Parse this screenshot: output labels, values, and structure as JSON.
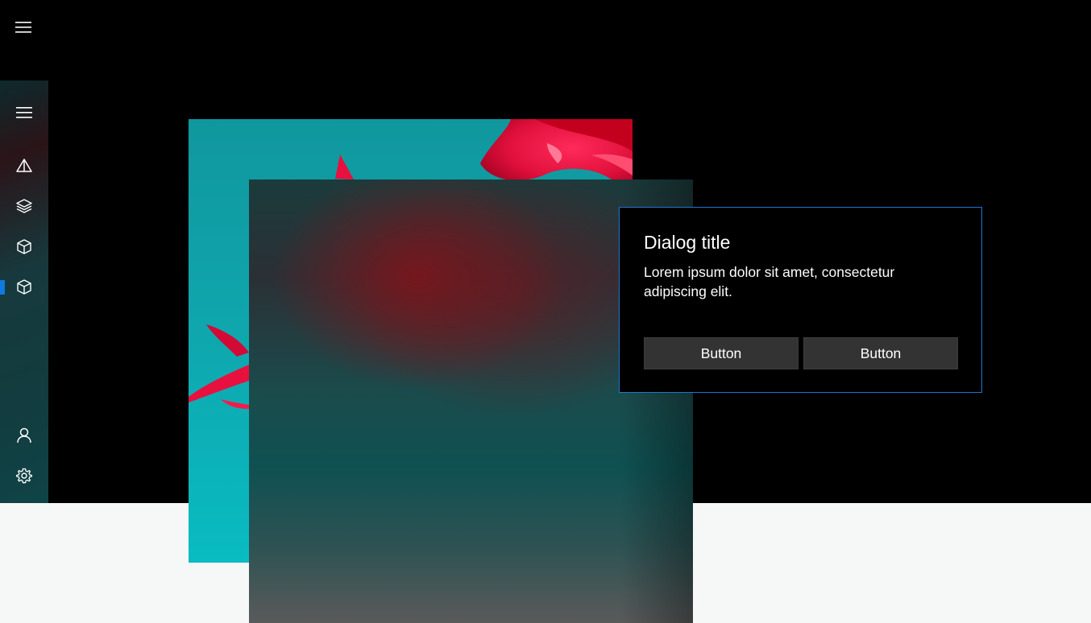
{
  "window": {
    "menu_icon": "hamburger-icon"
  },
  "nav_rail": {
    "items": [
      {
        "icon": "hamburger-icon",
        "selected": false
      },
      {
        "icon": "triangle-icon",
        "selected": false
      },
      {
        "icon": "layers-icon",
        "selected": false
      },
      {
        "icon": "cube-icon",
        "selected": false
      },
      {
        "icon": "cube-icon",
        "selected": true
      },
      {
        "icon": "person-icon",
        "selected": false
      },
      {
        "icon": "gear-icon",
        "selected": false
      }
    ]
  },
  "dialog": {
    "title": "Dialog title",
    "body": "Lorem ipsum dolor sit amet, consectetur adipiscing elit.",
    "buttons": [
      {
        "label": "Button"
      },
      {
        "label": "Button"
      }
    ]
  },
  "colors": {
    "accent": "#1f75d1",
    "selection_indicator": "#0f7ae0",
    "background_dark": "#000000",
    "background_light": "#f6f8f7",
    "button_bg": "#333333",
    "photo_cyan": "#0fa7ae",
    "photo_red": "#e8103e"
  }
}
